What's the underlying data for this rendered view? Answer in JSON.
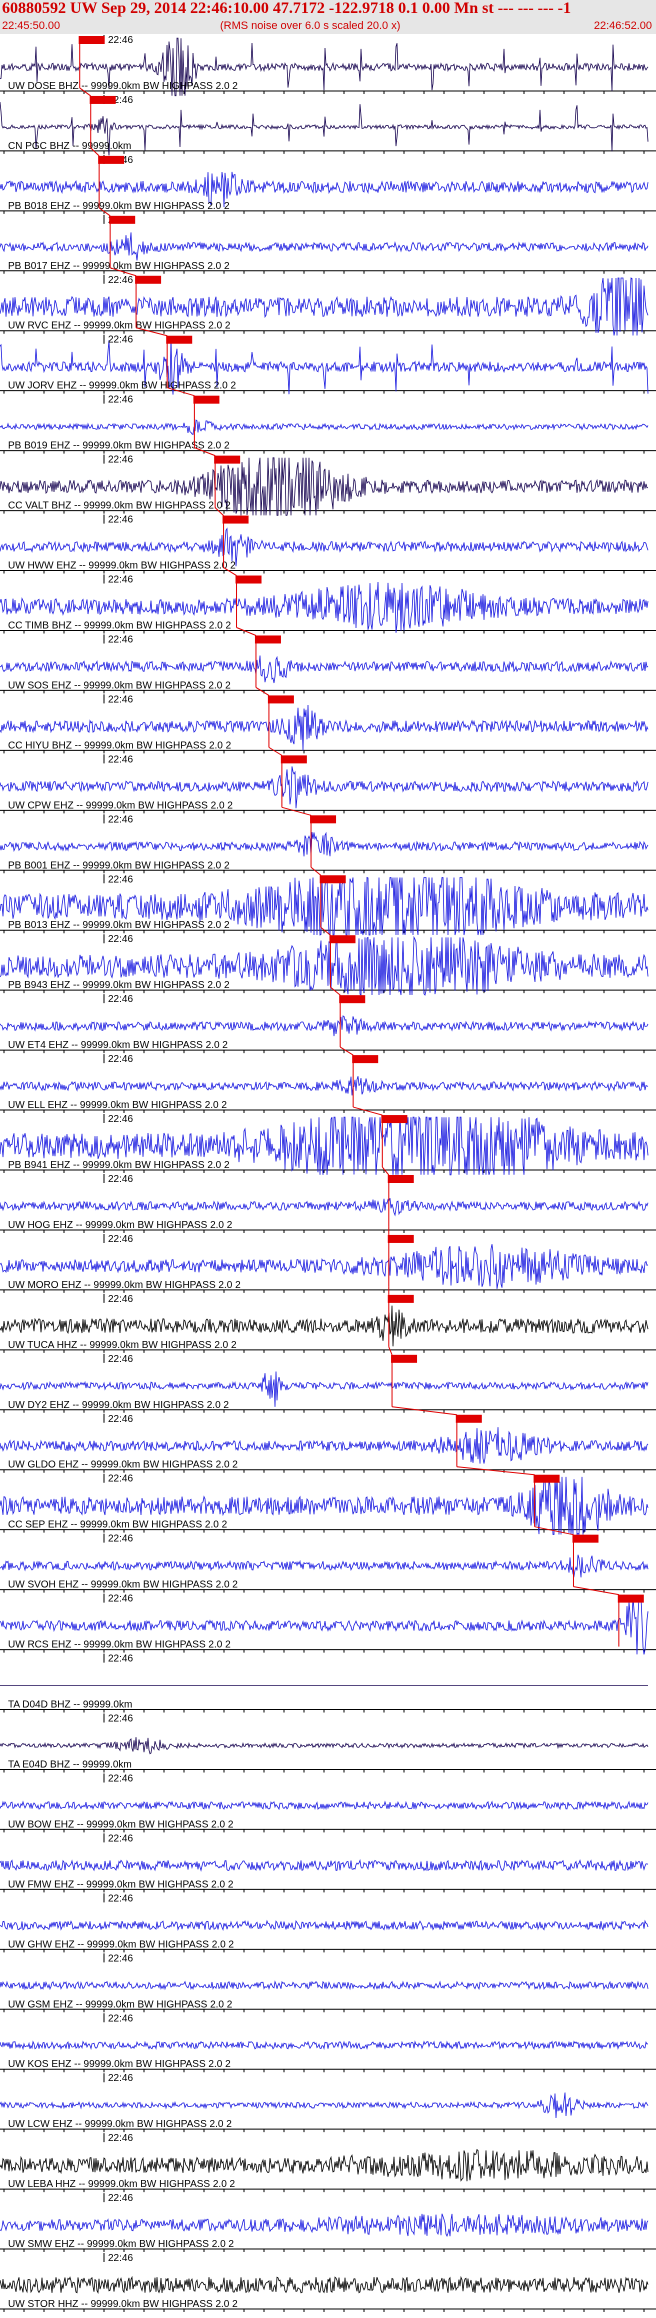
{
  "header": {
    "title": "60880592 UW Sep 29, 2014 22:46:10.00   47.7172 -122.9718  0.1 0.00 Mn st --- --- ---  -1",
    "start_time": "22:45:50.00",
    "note": "(RMS noise over 6.0 s scaled 20.0 x)",
    "end_time": "22:46:52.00"
  },
  "chart_data": {
    "type": "seismogram",
    "time_range": [
      "22:45:50.00",
      "22:46:52.00"
    ],
    "minute_tick_label": "22:46",
    "traces": [
      {
        "label": "UW DOSE BHZ -- 99999.0km BW  HIGHPASS  2.0  2",
        "color": "#1c0a54",
        "pick": true,
        "pick_rel": 0.123,
        "event_rel": 0.275,
        "event_amp": 3.0,
        "event_width": 0.016,
        "noise": 0.26,
        "spiky": true,
        "seed": 1
      },
      {
        "label": "CN PGC BHZ -- 99999.0km",
        "color": "#1c0a54",
        "pick": true,
        "pick_rel": 0.14,
        "event_rel": 0.16,
        "event_amp": 0.8,
        "event_width": 0.01,
        "noise": 0.14,
        "spiky": true,
        "seed": 2
      },
      {
        "label": "PB B018 EHZ -- 99999.0km BW  HIGHPASS  2.0  2",
        "color": "#1d1de0",
        "pick": true,
        "pick_rel": 0.153,
        "event_rel": 0.34,
        "event_amp": 1.2,
        "event_width": 0.02,
        "noise": 0.4,
        "spiky": false,
        "seed": 3
      },
      {
        "label": "PB B017 EHZ -- 99999.0km BW  HIGHPASS  2.0  2",
        "color": "#1d1de0",
        "pick": true,
        "pick_rel": 0.17,
        "event_rel": 0.2,
        "event_amp": 0.8,
        "event_width": 0.02,
        "noise": 0.3,
        "spiky": false,
        "seed": 4
      },
      {
        "label": "UW RVC EHZ -- 99999.0km BW  HIGHPASS  2.0  2",
        "color": "#1d1de0",
        "pick": true,
        "pick_rel": 0.21,
        "event_rel": 0.955,
        "event_amp": 2.8,
        "event_width": 0.035,
        "noise": 0.7,
        "spiky": false,
        "seed": 5
      },
      {
        "label": "UW JORV EHZ -- 99999.0km BW  HIGHPASS  2.0  2",
        "color": "#1d1de0",
        "pick": true,
        "pick_rel": 0.258,
        "event_rel": 0.265,
        "event_amp": 1.8,
        "event_width": 0.012,
        "noise": 0.35,
        "spiky": true,
        "seed": 6
      },
      {
        "label": "PB B019 EHZ -- 99999.0km BW  HIGHPASS  2.0  2",
        "color": "#1d1de0",
        "pick": true,
        "pick_rel": 0.3,
        "event_rel": 0.3,
        "event_amp": 0.4,
        "event_width": 0.02,
        "noise": 0.2,
        "spiky": false,
        "seed": 7
      },
      {
        "label": "CC VALT BHZ -- 99999.0km BW  HIGHPASS  2.0  2",
        "color": "#1c0a54",
        "pick": true,
        "pick_rel": 0.332,
        "event_rel": 0.43,
        "event_amp": 3.4,
        "event_width": 0.07,
        "noise": 0.45,
        "spiky": false,
        "seed": 8
      },
      {
        "label": "UW HWW EHZ -- 99999.0km BW  HIGHPASS  2.0  2",
        "color": "#1d1de0",
        "pick": true,
        "pick_rel": 0.345,
        "event_rel": 0.36,
        "event_amp": 1.1,
        "event_width": 0.02,
        "noise": 0.35,
        "spiky": false,
        "seed": 9
      },
      {
        "label": "CC TIMB BHZ -- 99999.0km BW  HIGHPASS  2.0  2",
        "color": "#1d1de0",
        "pick": true,
        "pick_rel": 0.365,
        "event_rel": 0.6,
        "event_amp": 1.3,
        "event_width": 0.12,
        "noise": 0.55,
        "spiky": false,
        "seed": 10
      },
      {
        "label": "UW SOS EHZ -- 99999.0km BW  HIGHPASS  2.0  2",
        "color": "#1d1de0",
        "pick": true,
        "pick_rel": 0.395,
        "event_rel": 0.42,
        "event_amp": 0.9,
        "event_width": 0.02,
        "noise": 0.35,
        "spiky": false,
        "seed": 11
      },
      {
        "label": "CC HIYU BHZ -- 99999.0km BW  HIGHPASS  2.0  2",
        "color": "#1d1de0",
        "pick": true,
        "pick_rel": 0.415,
        "event_rel": 0.465,
        "event_amp": 1.3,
        "event_width": 0.02,
        "noise": 0.4,
        "spiky": false,
        "seed": 12
      },
      {
        "label": "UW CPW EHZ -- 99999.0km BW  HIGHPASS  2.0  2",
        "color": "#1d1de0",
        "pick": true,
        "pick_rel": 0.435,
        "event_rel": 0.455,
        "event_amp": 1.2,
        "event_width": 0.02,
        "noise": 0.35,
        "spiky": false,
        "seed": 13
      },
      {
        "label": "PB B001 EHZ -- 99999.0km BW  HIGHPASS  2.0  2",
        "color": "#1d1de0",
        "pick": true,
        "pick_rel": 0.48,
        "event_rel": 0.49,
        "event_amp": 0.8,
        "event_width": 0.02,
        "noise": 0.3,
        "spiky": false,
        "seed": 14
      },
      {
        "label": "PB B013 EHZ -- 99999.0km BW  HIGHPASS  2.0  2",
        "color": "#1d1de0",
        "pick": true,
        "pick_rel": 0.495,
        "event_rel": 0.6,
        "event_amp": 2.6,
        "event_width": 0.15,
        "noise": 0.9,
        "spiky": false,
        "seed": 15
      },
      {
        "label": "PB B943 EHZ -- 99999.0km BW  HIGHPASS  2.0  2",
        "color": "#1d1de0",
        "pick": true,
        "pick_rel": 0.51,
        "event_rel": 0.62,
        "event_amp": 2.0,
        "event_width": 0.14,
        "noise": 0.8,
        "spiky": false,
        "seed": 16
      },
      {
        "label": "UW ET4 EHZ -- 99999.0km BW  HIGHPASS  2.0  2",
        "color": "#1d1de0",
        "pick": true,
        "pick_rel": 0.525,
        "event_rel": 0.53,
        "event_amp": 0.6,
        "event_width": 0.02,
        "noise": 0.3,
        "spiky": false,
        "seed": 17
      },
      {
        "label": "UW ELL EHZ -- 99999.0km BW  HIGHPASS  2.0  2",
        "color": "#1d1de0",
        "pick": true,
        "pick_rel": 0.545,
        "event_rel": 0.55,
        "event_amp": 0.5,
        "event_width": 0.02,
        "noise": 0.3,
        "spiky": false,
        "seed": 18
      },
      {
        "label": "PB B941 EHZ -- 99999.0km BW  HIGHPASS  2.0  2",
        "color": "#1d1de0",
        "pick": true,
        "pick_rel": 0.59,
        "event_rel": 0.65,
        "event_amp": 2.8,
        "event_width": 0.16,
        "noise": 0.9,
        "spiky": false,
        "seed": 19
      },
      {
        "label": "UW HOG EHZ -- 99999.0km BW  HIGHPASS  2.0  2",
        "color": "#1d1de0",
        "pick": true,
        "pick_rel": 0.6,
        "event_rel": 0.6,
        "event_amp": 0.4,
        "event_width": 0.02,
        "noise": 0.3,
        "spiky": false,
        "seed": 20
      },
      {
        "label": "UW MORO EHZ -- 99999.0km BW  HIGHPASS  2.0  2",
        "color": "#1d1de0",
        "pick": true,
        "pick_rel": 0.6,
        "event_rel": 0.75,
        "event_amp": 1.2,
        "event_width": 0.12,
        "noise": 0.45,
        "spiky": false,
        "seed": 21
      },
      {
        "label": "UW TUCA HHZ -- 99999.0km BW  HIGHPASS  2.0  2",
        "color": "#000000",
        "pick": true,
        "pick_rel": 0.6,
        "event_rel": 0.605,
        "event_amp": 1.0,
        "event_width": 0.015,
        "noise": 0.5,
        "spiky": false,
        "seed": 22
      },
      {
        "label": "UW DY2 EHZ -- 99999.0km BW  HIGHPASS  2.0  2",
        "color": "#1d1de0",
        "pick": true,
        "pick_rel": 0.605,
        "event_rel": 0.42,
        "event_amp": 1.4,
        "event_width": 0.008,
        "noise": 0.25,
        "spiky": false,
        "seed": 23
      },
      {
        "label": "UW GLDO EHZ -- 99999.0km BW  HIGHPASS  2.0  2",
        "color": "#1d1de0",
        "pick": true,
        "pick_rel": 0.705,
        "event_rel": 0.76,
        "event_amp": 1.0,
        "event_width": 0.06,
        "noise": 0.35,
        "spiky": false,
        "seed": 24
      },
      {
        "label": "CC SEP EHZ -- 99999.0km BW  HIGHPASS  2.0  2",
        "color": "#1d1de0",
        "pick": true,
        "pick_rel": 0.825,
        "event_rel": 0.875,
        "event_amp": 3.0,
        "event_width": 0.04,
        "noise": 0.65,
        "spiky": false,
        "seed": 25
      },
      {
        "label": "UW SVOH EHZ -- 99999.0km BW  HIGHPASS  2.0  2",
        "color": "#1d1de0",
        "pick": true,
        "pick_rel": 0.885,
        "event_rel": 0.9,
        "event_amp": 0.6,
        "event_width": 0.02,
        "noise": 0.3,
        "spiky": false,
        "seed": 26
      },
      {
        "label": "UW RCS EHZ -- 99999.0km BW  HIGHPASS  2.0  2",
        "color": "#1d1de0",
        "pick": true,
        "pick_rel": 0.955,
        "event_rel": 0.985,
        "event_amp": 3.0,
        "event_width": 0.012,
        "noise": 0.35,
        "spiky": false,
        "seed": 27
      },
      {
        "label": "TA D04D BHZ -- 99999.0km",
        "color": "#1c0a54",
        "pick": false,
        "pick_rel": 0,
        "event_rel": 0,
        "event_amp": 0,
        "event_width": 0.02,
        "noise": 0.0,
        "spiky": false,
        "seed": 28
      },
      {
        "label": "TA E04D BHZ -- 99999.0km",
        "color": "#1c0a54",
        "pick": false,
        "pick_rel": 0,
        "event_rel": 0.22,
        "event_amp": 0.5,
        "event_width": 0.03,
        "noise": 0.15,
        "spiky": false,
        "seed": 29
      },
      {
        "label": "UW BOW EHZ -- 99999.0km BW  HIGHPASS  2.0  2",
        "color": "#1d1de0",
        "pick": false,
        "pick_rel": 0,
        "event_rel": 0,
        "event_amp": 0,
        "event_width": 0.02,
        "noise": 0.25,
        "spiky": false,
        "seed": 30
      },
      {
        "label": "UW FMW EHZ -- 99999.0km BW  HIGHPASS  2.0  2",
        "color": "#1d1de0",
        "pick": false,
        "pick_rel": 0,
        "event_rel": 0,
        "event_amp": 0,
        "event_width": 0.02,
        "noise": 0.35,
        "spiky": false,
        "seed": 31
      },
      {
        "label": "UW GHW EHZ -- 99999.0km BW  HIGHPASS  2.0  2",
        "color": "#1d1de0",
        "pick": false,
        "pick_rel": 0,
        "event_rel": 0,
        "event_amp": 0,
        "event_width": 0.02,
        "noise": 0.3,
        "spiky": false,
        "seed": 32
      },
      {
        "label": "UW GSM EHZ -- 99999.0km BW  HIGHPASS  2.0  2",
        "color": "#1d1de0",
        "pick": false,
        "pick_rel": 0,
        "event_rel": 0,
        "event_amp": 0,
        "event_width": 0.02,
        "noise": 0.25,
        "spiky": false,
        "seed": 33
      },
      {
        "label": "UW KOS EHZ -- 99999.0km BW  HIGHPASS  2.0  2",
        "color": "#1d1de0",
        "pick": false,
        "pick_rel": 0,
        "event_rel": 0,
        "event_amp": 0,
        "event_width": 0.02,
        "noise": 0.25,
        "spiky": false,
        "seed": 34
      },
      {
        "label": "UW LCW EHZ -- 99999.0km BW  HIGHPASS  2.0  2",
        "color": "#1d1de0",
        "pick": false,
        "pick_rel": 0,
        "event_rel": 0.865,
        "event_amp": 0.8,
        "event_width": 0.02,
        "noise": 0.2,
        "spiky": false,
        "seed": 35
      },
      {
        "label": "UW LEBA HHZ -- 99999.0km BW  HIGHPASS  2.0  2",
        "color": "#000000",
        "pick": false,
        "pick_rel": 0,
        "event_rel": 0.75,
        "event_amp": 0.6,
        "event_width": 0.15,
        "noise": 0.55,
        "spiky": false,
        "seed": 36
      },
      {
        "label": "UW SMW EHZ -- 99999.0km BW  HIGHPASS  2.0  2",
        "color": "#1d1de0",
        "pick": false,
        "pick_rel": 0,
        "event_rel": 0.7,
        "event_amp": 0.4,
        "event_width": 0.2,
        "noise": 0.4,
        "spiky": false,
        "seed": 37
      },
      {
        "label": "UW STOR HHZ -- 99999.0km BW  HIGHPASS  2.0  2",
        "color": "#000000",
        "pick": false,
        "pick_rel": 0,
        "event_rel": 0,
        "event_amp": 0,
        "event_width": 0.02,
        "noise": 0.55,
        "spiky": false,
        "seed": 38
      }
    ],
    "grid": false,
    "legend": "none"
  }
}
